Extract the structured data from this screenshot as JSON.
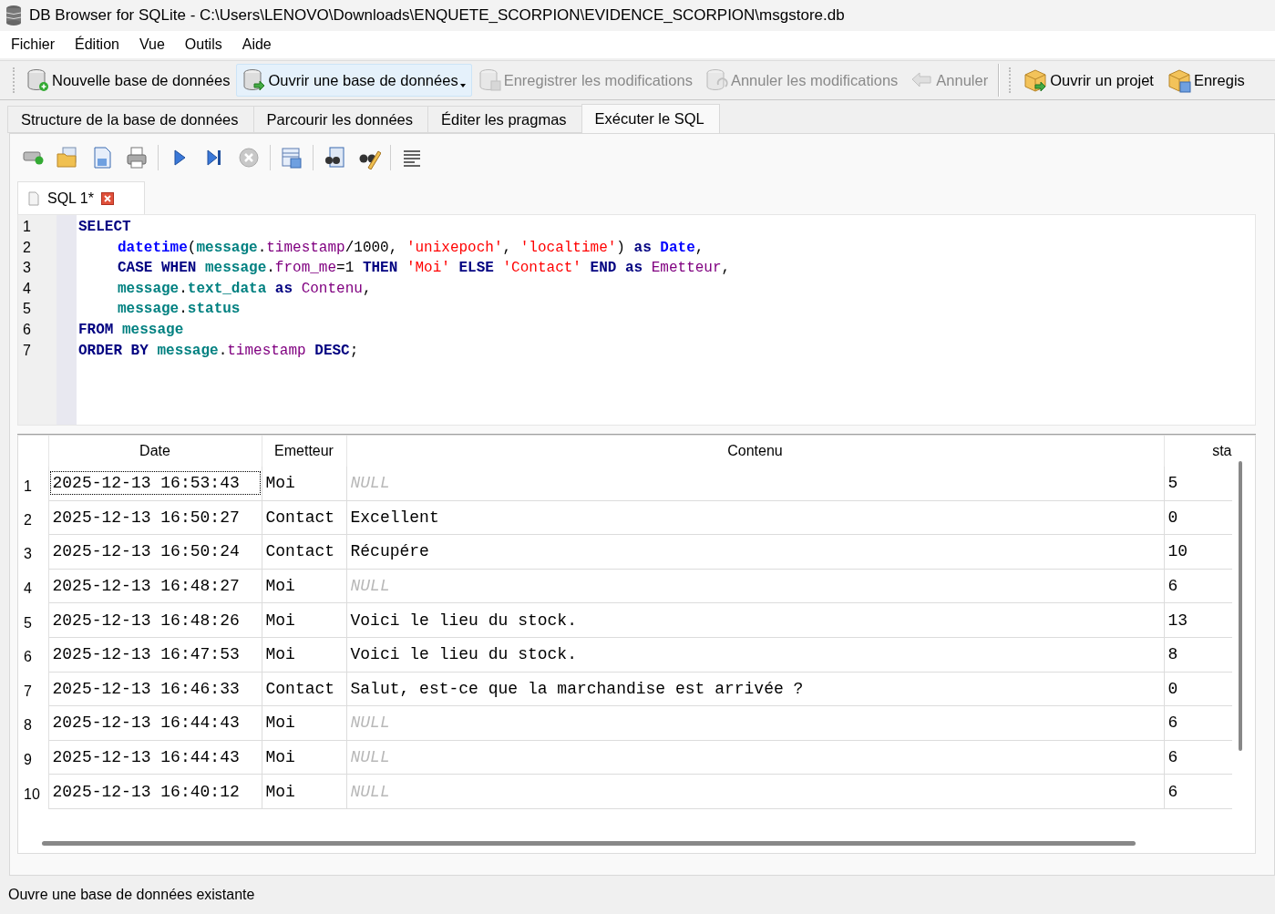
{
  "window": {
    "title": "DB Browser for SQLite - C:\\Users\\LENOVO\\Downloads\\ENQUETE_SCORPION\\EVIDENCE_SCORPION\\msgstore.db"
  },
  "menu": [
    "Fichier",
    "Édition",
    "Vue",
    "Outils",
    "Aide"
  ],
  "toolbar": {
    "groups": [
      [
        {
          "label": "Nouvelle base de données",
          "disabled": false,
          "hovered": false,
          "dropdown": false
        },
        {
          "label": "Ouvrir une base de données",
          "disabled": false,
          "hovered": true,
          "dropdown": true
        },
        {
          "label": "Enregistrer les modifications",
          "disabled": true,
          "hovered": false,
          "dropdown": false
        },
        {
          "label": "Annuler les modifications",
          "disabled": true,
          "hovered": false,
          "dropdown": false
        },
        {
          "label": "Annuler",
          "disabled": true,
          "hovered": false,
          "dropdown": false
        }
      ],
      [
        {
          "label": "Ouvrir un projet",
          "disabled": false,
          "hovered": false,
          "dropdown": false
        },
        {
          "label": "Enregis",
          "disabled": false,
          "hovered": false,
          "dropdown": false
        }
      ]
    ]
  },
  "tabs": [
    {
      "label": "Structure de la base de données",
      "selected": false
    },
    {
      "label": "Parcourir les données",
      "selected": false
    },
    {
      "label": "Éditer les pragmas",
      "selected": false
    },
    {
      "label": "Exécuter le SQL",
      "selected": true
    }
  ],
  "sql_toolbar": {
    "stop_disabled": true
  },
  "editor_tabs": [
    {
      "label": "SQL 1*",
      "selected": true
    }
  ],
  "code": [
    {
      "number": "1",
      "indent": false,
      "tokens": [
        {
          "kind": "kw",
          "text": "SELECT"
        }
      ]
    },
    {
      "number": "2",
      "indent": true,
      "tokens": [
        {
          "kind": "fn",
          "text": "datetime"
        },
        {
          "kind": "txt",
          "text": "("
        },
        {
          "kind": "tbl",
          "text": "message"
        },
        {
          "kind": "txt",
          "text": "."
        },
        {
          "kind": "fld",
          "text": "timestamp"
        },
        {
          "kind": "txt",
          "text": "/1000, "
        },
        {
          "kind": "str",
          "text": "'unixepoch'"
        },
        {
          "kind": "txt",
          "text": ", "
        },
        {
          "kind": "str",
          "text": "'localtime'"
        },
        {
          "kind": "txt",
          "text": ") "
        },
        {
          "kind": "kw",
          "text": "as"
        },
        {
          "kind": "fn",
          "text": " Date"
        },
        {
          "kind": "txt",
          "text": ","
        }
      ]
    },
    {
      "number": "3",
      "indent": true,
      "tokens": [
        {
          "kind": "kw",
          "text": "CASE WHEN "
        },
        {
          "kind": "tbl",
          "text": "message"
        },
        {
          "kind": "txt",
          "text": "."
        },
        {
          "kind": "fld",
          "text": "from_me"
        },
        {
          "kind": "txt",
          "text": "=1 "
        },
        {
          "kind": "kw",
          "text": "THEN "
        },
        {
          "kind": "str",
          "text": "'Moi'"
        },
        {
          "kind": "kw",
          "text": " ELSE "
        },
        {
          "kind": "str",
          "text": "'Contact'"
        },
        {
          "kind": "kw",
          "text": " END as "
        },
        {
          "kind": "fld",
          "text": "Emetteur"
        },
        {
          "kind": "txt",
          "text": ","
        }
      ]
    },
    {
      "number": "4",
      "indent": true,
      "tokens": [
        {
          "kind": "tbl",
          "text": "message"
        },
        {
          "kind": "txt",
          "text": "."
        },
        {
          "kind": "tbl",
          "text": "text_data"
        },
        {
          "kind": "kw",
          "text": " as "
        },
        {
          "kind": "fld",
          "text": "Contenu"
        },
        {
          "kind": "txt",
          "text": ","
        }
      ]
    },
    {
      "number": "5",
      "indent": true,
      "tokens": [
        {
          "kind": "tbl",
          "text": "message"
        },
        {
          "kind": "txt",
          "text": "."
        },
        {
          "kind": "tbl",
          "text": "status"
        }
      ]
    },
    {
      "number": "6",
      "indent": false,
      "tokens": [
        {
          "kind": "kw",
          "text": "FROM "
        },
        {
          "kind": "tbl",
          "text": "message"
        }
      ]
    },
    {
      "number": "7",
      "indent": false,
      "tokens": [
        {
          "kind": "kw",
          "text": "ORDER BY "
        },
        {
          "kind": "tbl",
          "text": "message"
        },
        {
          "kind": "txt",
          "text": "."
        },
        {
          "kind": "fld",
          "text": "timestamp"
        },
        {
          "kind": "kw",
          "text": " DESC"
        },
        {
          "kind": "txt",
          "text": ";"
        }
      ]
    }
  ],
  "results": {
    "columns": [
      "Date",
      "Emetteur",
      "Contenu",
      "sta"
    ],
    "rows": [
      {
        "number": "1",
        "focused": true,
        "date": "2025-12-13 16:53:43",
        "sender": "Moi",
        "content": "NULL",
        "content_null": true,
        "status": "5"
      },
      {
        "number": "2",
        "focused": false,
        "date": "2025-12-13 16:50:27",
        "sender": "Contact",
        "content": "Excellent",
        "content_null": false,
        "status": "0"
      },
      {
        "number": "3",
        "focused": false,
        "date": "2025-12-13 16:50:24",
        "sender": "Contact",
        "content": "Récupére",
        "content_null": false,
        "status": "10"
      },
      {
        "number": "4",
        "focused": false,
        "date": "2025-12-13 16:48:27",
        "sender": "Moi",
        "content": "NULL",
        "content_null": true,
        "status": "6"
      },
      {
        "number": "5",
        "focused": false,
        "date": "2025-12-13 16:48:26",
        "sender": "Moi",
        "content": "Voici le lieu du stock.",
        "content_null": false,
        "status": "13"
      },
      {
        "number": "6",
        "focused": false,
        "date": "2025-12-13 16:47:53",
        "sender": "Moi",
        "content": "Voici le lieu du stock.",
        "content_null": false,
        "status": "8"
      },
      {
        "number": "7",
        "focused": false,
        "date": "2025-12-13 16:46:33",
        "sender": "Contact",
        "content": "Salut, est-ce que la marchandise est arrivée ?",
        "content_null": false,
        "status": "0"
      },
      {
        "number": "8",
        "focused": false,
        "date": "2025-12-13 16:44:43",
        "sender": "Moi",
        "content": "NULL",
        "content_null": true,
        "status": "6"
      },
      {
        "number": "9",
        "focused": false,
        "date": "2025-12-13 16:44:43",
        "sender": "Moi",
        "content": "NULL",
        "content_null": true,
        "status": "6"
      },
      {
        "number": "10",
        "focused": false,
        "date": "2025-12-13 16:40:12",
        "sender": "Moi",
        "content": "NULL",
        "content_null": true,
        "status": "6"
      }
    ]
  },
  "status_bar": {
    "text": "Ouvre une base de données existante"
  }
}
